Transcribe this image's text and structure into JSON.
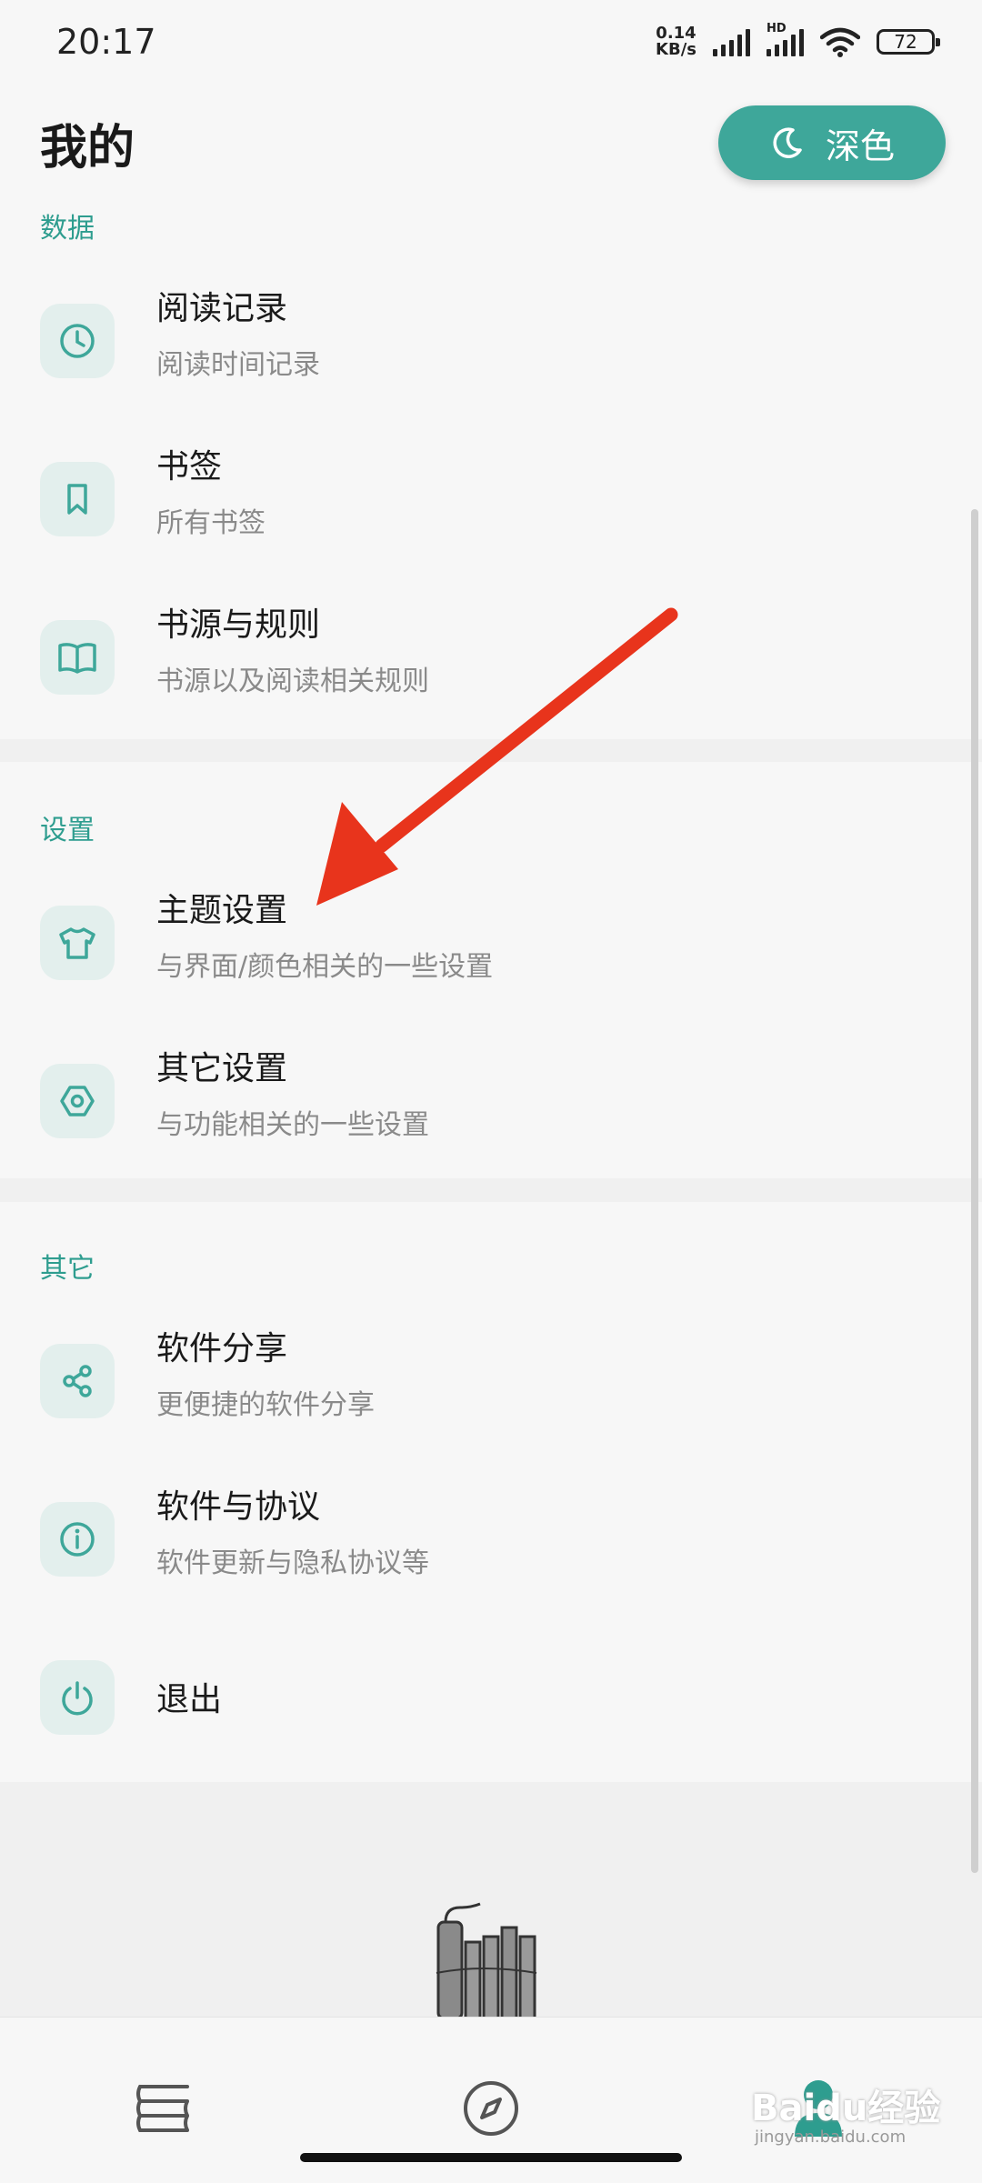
{
  "status_bar": {
    "time": "20:17",
    "net_speed_value": "0.14",
    "net_speed_unit": "KB/s",
    "hd_label": "HD",
    "battery": "72",
    "icons": [
      "signal-icon",
      "signal-hd-icon",
      "wifi-icon",
      "battery-icon"
    ]
  },
  "header": {
    "title": "我的",
    "theme_button_label": "深色",
    "theme_button_icon": "moon-icon"
  },
  "sections": [
    {
      "title": "数据",
      "items": [
        {
          "title": "阅读记录",
          "subtitle": "阅读时间记录",
          "icon": "clock-icon"
        },
        {
          "title": "书签",
          "subtitle": "所有书签",
          "icon": "bookmark-icon"
        },
        {
          "title": "书源与规则",
          "subtitle": "书源以及阅读相关规则",
          "icon": "book-open-icon"
        }
      ]
    },
    {
      "title": "设置",
      "items": [
        {
          "title": "主题设置",
          "subtitle": "与界面/颜色相关的一些设置",
          "icon": "tshirt-icon"
        },
        {
          "title": "其它设置",
          "subtitle": "与功能相关的一些设置",
          "icon": "hexagon-settings-icon"
        }
      ]
    },
    {
      "title": "其它",
      "items": [
        {
          "title": "软件分享",
          "subtitle": "更便捷的软件分享",
          "icon": "share-icon"
        },
        {
          "title": "软件与协议",
          "subtitle": "软件更新与隐私协议等",
          "icon": "info-icon"
        },
        {
          "title": "退出",
          "subtitle": "",
          "icon": "power-icon"
        }
      ]
    }
  ],
  "bottom_nav": [
    "bookshelf-icon",
    "compass-icon",
    "profile-icon"
  ],
  "watermark": {
    "text": "Baidu经验",
    "sub": "jingyan.baidu.com"
  },
  "colors": {
    "accent": "#3ea79a",
    "section_title": "#2e9d8f",
    "annotation_arrow": "#e8341c"
  }
}
